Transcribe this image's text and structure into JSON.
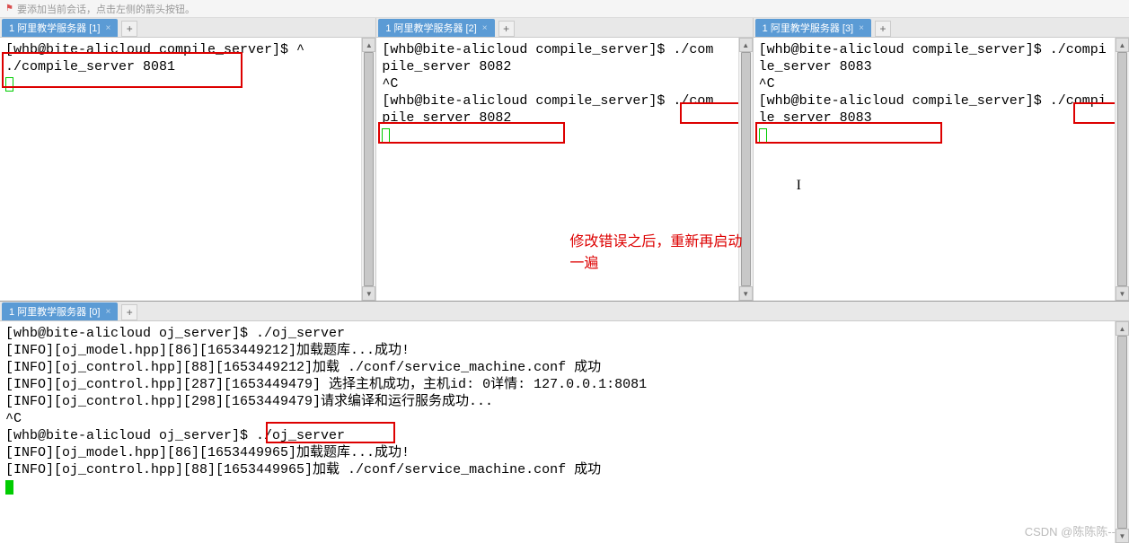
{
  "hint": "要添加当前会话，点击左侧的箭头按钮。",
  "panes": [
    {
      "tab": "1 阿里教学服务器 [1]",
      "lines": [
        "[whb@bite-alicloud compile_server]$ ^",
        "./compile_server 8081"
      ]
    },
    {
      "tab": "1 阿里教学服务器 [2]",
      "lines": [
        "[whb@bite-alicloud compile_server]$ ./com",
        "pile_server 8082",
        "^C",
        "[whb@bite-alicloud compile_server]$ ./com",
        "pile_server 8082"
      ]
    },
    {
      "tab": "1 阿里教学服务器 [3]",
      "lines": [
        "[whb@bite-alicloud compile_server]$ ./compi",
        "le_server 8083",
        "^C",
        "[whb@bite-alicloud compile_server]$ ./compi",
        "le_server 8083"
      ]
    }
  ],
  "annotation": "修改错误之后，重新再启动一遍",
  "bottom": {
    "tab": "1 阿里教学服务器 [0]",
    "lines": [
      "[whb@bite-alicloud oj_server]$ ./oj_server",
      "[INFO][oj_model.hpp][86][1653449212]加载题库...成功!",
      "[INFO][oj_control.hpp][88][1653449212]加载 ./conf/service_machine.conf 成功",
      "[INFO][oj_control.hpp][287][1653449479] 选择主机成功，主机id: 0详情: 127.0.0.1:8081",
      "[INFO][oj_control.hpp][298][1653449479]请求编译和运行服务成功...",
      "^C",
      "[whb@bite-alicloud oj_server]$ ./oj_server",
      "[INFO][oj_model.hpp][86][1653449965]加载题库...成功!",
      "[INFO][oj_control.hpp][88][1653449965]加载 ./conf/service_machine.conf 成功"
    ]
  },
  "watermark": "CSDN @陈陈陈--",
  "closeGlyph": "×",
  "addGlyph": "+"
}
